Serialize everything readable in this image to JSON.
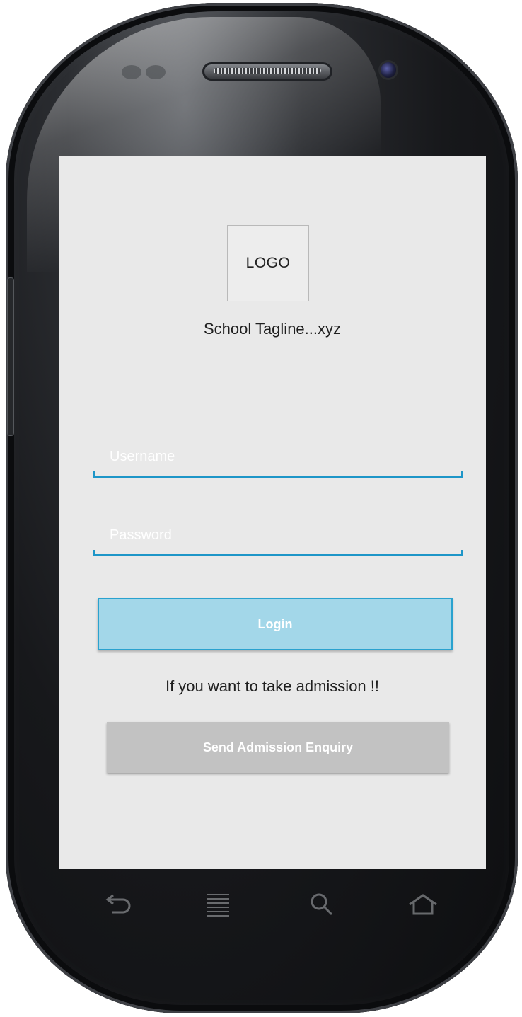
{
  "login": {
    "logo_text": "LOGO",
    "tagline": "School Tagline...xyz",
    "username_placeholder": "Username",
    "password_placeholder": "Password",
    "login_label": "Login"
  },
  "admission": {
    "prompt": "If you want to take admission !!",
    "enquiry_label": "Send Admission Enquiry"
  },
  "nav_keys": {
    "back": "back-icon",
    "menu": "menu-icon",
    "search": "search-icon",
    "home": "home-icon"
  },
  "colors": {
    "accent": "#1e96c8",
    "login_button_bg": "#a3d7e9",
    "enquiry_button_bg": "#c2c2c2",
    "screen_bg": "#e9e9e9"
  }
}
